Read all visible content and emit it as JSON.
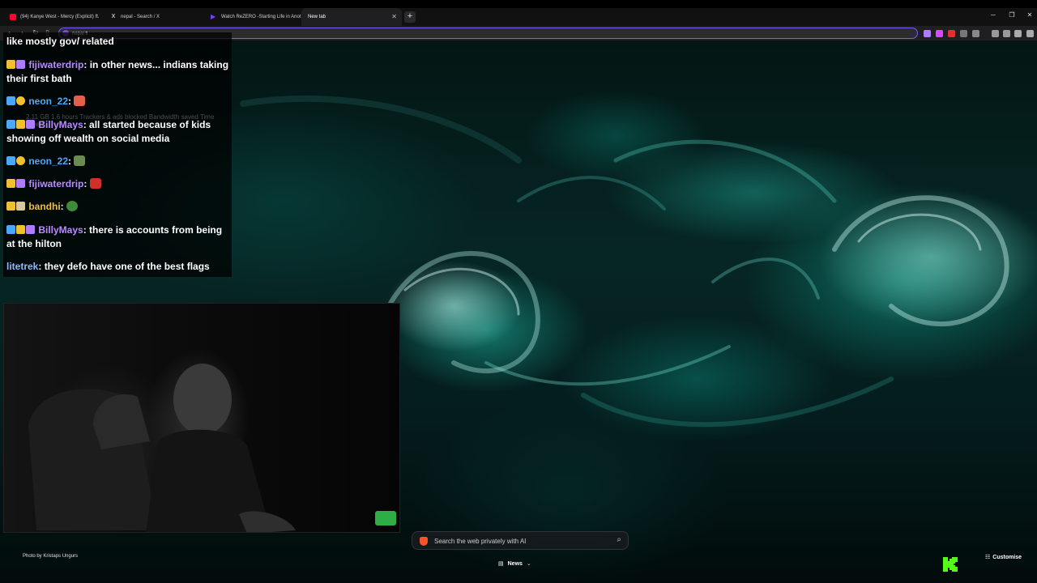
{
  "tabs": [
    {
      "title": "(94) Kanye West - Mercy (Explicit) ft.",
      "favicon": "youtube-icon",
      "color": "#ff0033",
      "active": false
    },
    {
      "title": "nepal - Search / X",
      "favicon": "x-icon",
      "color": "#ffffff",
      "active": false
    },
    {
      "title": "Watch ReZERO -Starting Life in Anot",
      "favicon": "play-icon",
      "color": "#7a3cff",
      "active": false
    },
    {
      "title": "New tab",
      "favicon": "",
      "color": "",
      "active": true
    }
  ],
  "toolbar": {
    "address_value": "nepal fl"
  },
  "chat": {
    "stats_ghost": "2.11 GB   1.6 hours   Trackers & ads blocked   Bandwidth saved   Time saved",
    "messages": [
      {
        "user": "",
        "user_color": "#ffffff",
        "text": "like mostly gov/ related",
        "emote": ""
      },
      {
        "user": "fijiwaterdrip",
        "user_color": "#b98bff",
        "text": ": in other news... indians taking their first bath",
        "emote": ""
      },
      {
        "user": "neon_22",
        "user_color": "#4aa8ff",
        "text": ":",
        "emote": "pepe-emote"
      },
      {
        "user": "BillyMays",
        "user_color": "#b98bff",
        "text": ": all started because of kids showing off wealth on social media",
        "emote": ""
      },
      {
        "user": "neon_22",
        "user_color": "#4aa8ff",
        "text": ":",
        "emote": "face-emote"
      },
      {
        "user": "fijiwaterdrip",
        "user_color": "#b98bff",
        "text": ":",
        "emote": "red-emote"
      },
      {
        "user": "bandhi",
        "user_color": "#f0c030",
        "text": ":",
        "emote": "frog-emote"
      },
      {
        "user": "BillyMays",
        "user_color": "#b98bff",
        "text": ": there is accounts from being at the hilton",
        "emote": ""
      },
      {
        "user": "litetrek",
        "user_color": "#8fb8ff",
        "text": ": they defo have one of the best flags",
        "emote": ""
      }
    ]
  },
  "newtab": {
    "photo_credit": "Photo by Kristaps Ungurs",
    "search_placeholder": "Search the web privately with AI",
    "news_label": "News",
    "customise_label": "Customise"
  },
  "colors": {
    "accent": "#7b5cff",
    "kick_green": "#53fc18",
    "brave_orange": "#fb542b"
  }
}
